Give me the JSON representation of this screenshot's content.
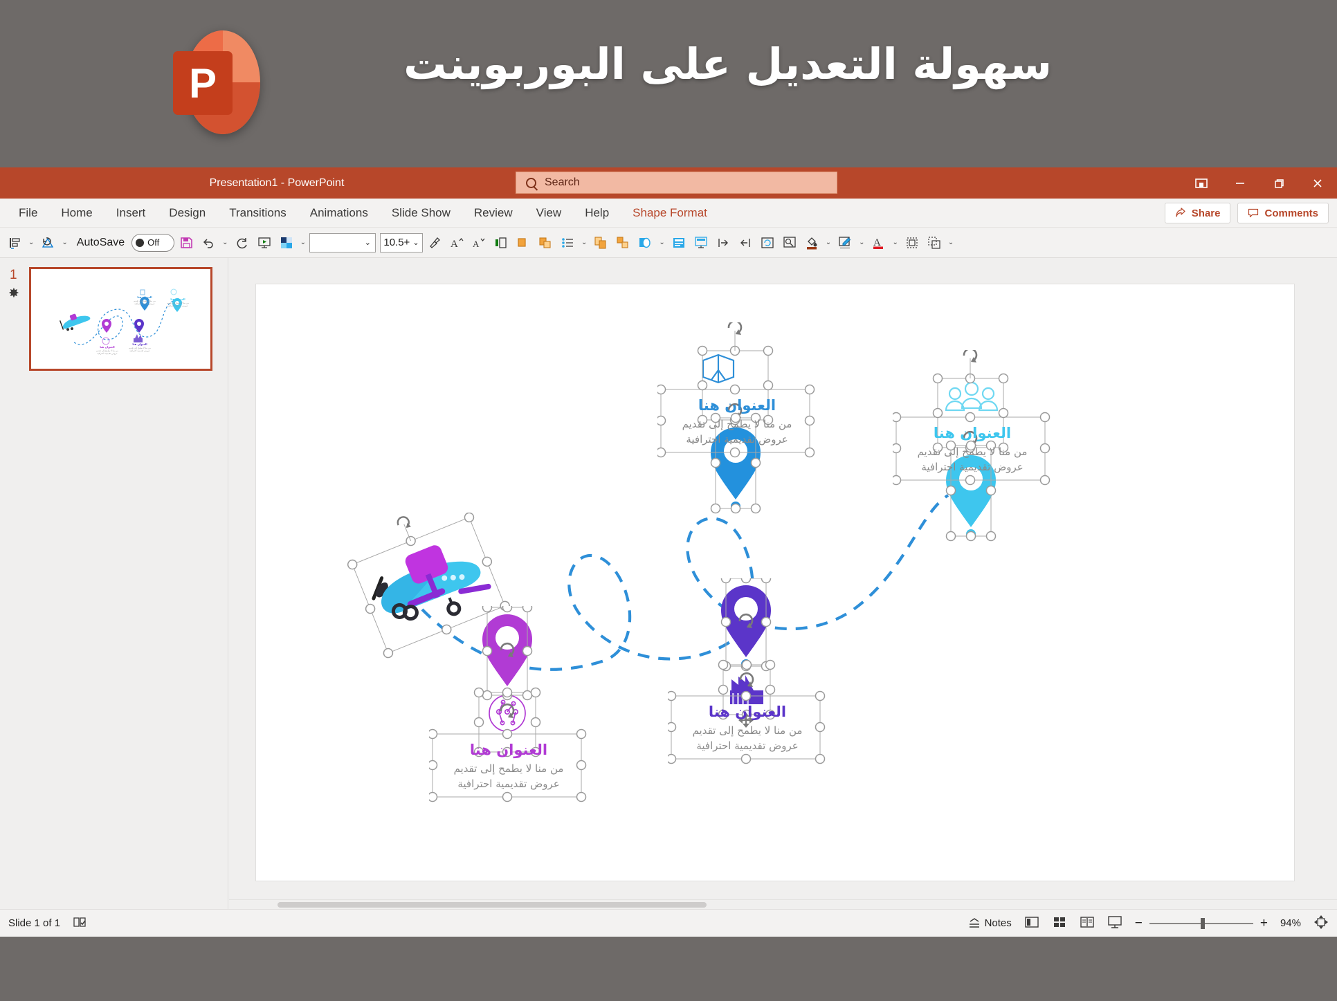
{
  "promo": {
    "title": "سهولة التعديل على البوربوينت",
    "logo_letter": "P",
    "logo_name": "powerpoint-logo",
    "bg_color": "#6e6a68"
  },
  "window": {
    "title": "Presentation1  -  PowerPoint",
    "accent_color": "#b7472a",
    "buttons": {
      "ribbon_display": "⬓",
      "minimize": "—",
      "restore": "❐",
      "close": "✕"
    }
  },
  "search": {
    "placeholder": "Search",
    "icon": "search-icon"
  },
  "ribbon": {
    "tabs": [
      {
        "label": "File",
        "active": false
      },
      {
        "label": "Home",
        "active": false
      },
      {
        "label": "Insert",
        "active": false
      },
      {
        "label": "Design",
        "active": false
      },
      {
        "label": "Transitions",
        "active": false
      },
      {
        "label": "Animations",
        "active": false
      },
      {
        "label": "Slide Show",
        "active": false
      },
      {
        "label": "Review",
        "active": false
      },
      {
        "label": "View",
        "active": false
      },
      {
        "label": "Help",
        "active": false
      },
      {
        "label": "Shape Format",
        "active": true
      }
    ],
    "share_label": "Share",
    "comments_label": "Comments"
  },
  "toolbar": {
    "autosave_label": "AutoSave",
    "autosave_state": "Off",
    "font_name": "",
    "font_size": "10.5+",
    "icons": [
      "align-left-icon",
      "dropdown-caret",
      "rotate-shape-icon",
      "dropdown-caret",
      "save-icon",
      "undo-icon",
      "dropdown-caret",
      "redo-icon",
      "start-slideshow-icon",
      "shape-fill-icon",
      "dropdown-caret",
      "format-painter-icon",
      "increase-font-size-icon",
      "decrease-font-size-icon",
      "text-align-icon",
      "shape-outline-icon",
      "shape-effects-icon",
      "bullets-icon",
      "dropdown-caret",
      "duplicate-icon",
      "group-icon",
      "insert-shape-icon",
      "dropdown-caret",
      "text-box-icon",
      "slide-layout-icon",
      "increase-indent-icon",
      "decrease-indent-icon",
      "reset-icon",
      "zoom-icon",
      "fill-color-icon",
      "dropdown-caret",
      "pen-color-icon",
      "dropdown-caret",
      "font-color-icon",
      "dropdown-caret",
      "arrange-icon",
      "selection-pane-icon",
      "overflow-caret"
    ]
  },
  "thumbnail_pane": {
    "slide_number": "1",
    "has_animation_star": true,
    "star_glyph": "✸"
  },
  "slide": {
    "markers": [
      {
        "id": "marker-blue",
        "title": "العنوان هنا",
        "body": "من منا لا يطمح إلى تقديم\nعروض تقديمية احترافية",
        "color": "#2e8fd8",
        "icon": "book-open-icon",
        "selected": true
      },
      {
        "id": "marker-cyan",
        "title": "العنوان هنا",
        "body": "من منا لا يطمح إلى تقديم\nعروض تقديمية احترافية",
        "color": "#3ec6ee",
        "icon": "people-group-icon",
        "selected": true
      },
      {
        "id": "marker-magenta",
        "title": "العنوان هنا",
        "body": "من منا لا يطمح إلى تقديم\nعروض تقديمية احترافية",
        "color": "#b13bd4",
        "icon": "globe-network-icon",
        "selected": true
      },
      {
        "id": "marker-violet",
        "title": "العنوان هنا",
        "body": "من منا لا يطمح إلى تقديم\nعروض تقديمية احترافية",
        "color": "#5b35c9",
        "icon": "factory-icon",
        "selected": true
      }
    ],
    "airplane": {
      "name": "airplane-graphic",
      "body_color": "#3ec6ee",
      "accent_color": "#b13bd4",
      "selected": true
    },
    "dashed_path_color": "#2e8fd8"
  },
  "status": {
    "slide_indicator": "Slide 1 of 1",
    "accessibility_icon": "accessibility-checker-icon",
    "notes_label": "Notes",
    "view_buttons": [
      "normal-view-icon",
      "slide-sorter-icon",
      "reading-view-icon",
      "slideshow-view-icon"
    ],
    "zoom_minus": "−",
    "zoom_plus": "+",
    "zoom_level": "94%",
    "fit_slide_icon": "fit-to-window-icon"
  }
}
